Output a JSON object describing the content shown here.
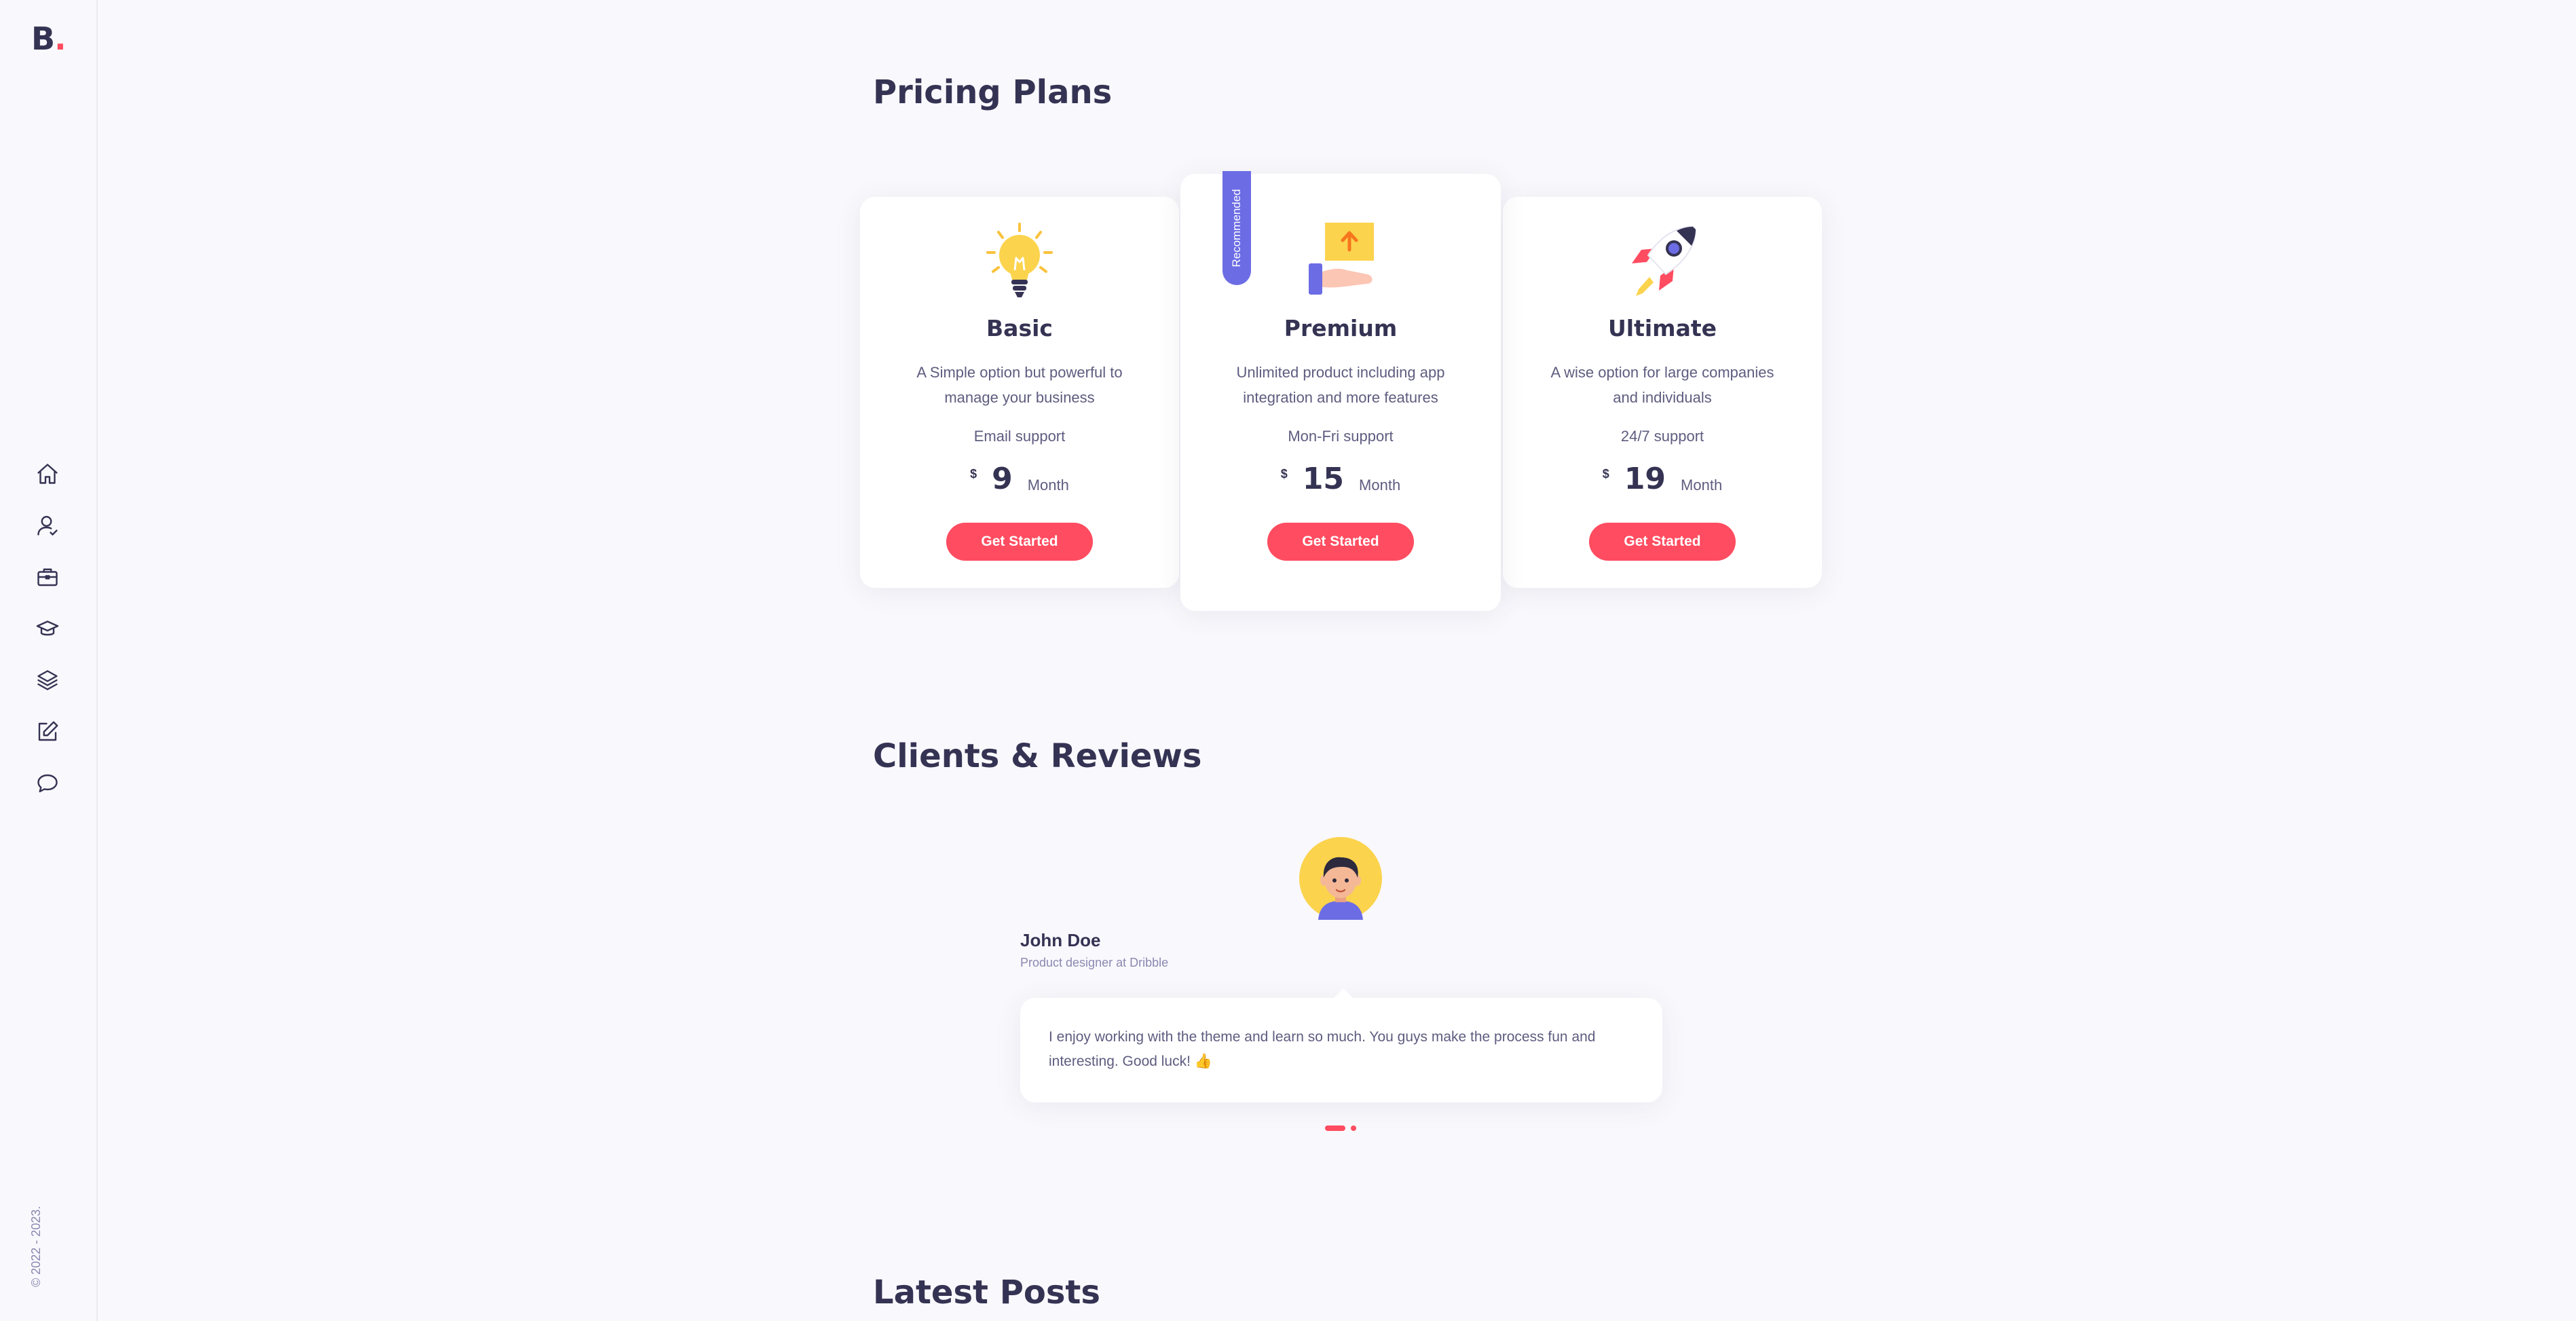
{
  "logo": {
    "letter": "B",
    "dot": "."
  },
  "copyright": "© 2022 - 2023.",
  "nav": [
    {
      "icon": "home-icon",
      "label": "Home"
    },
    {
      "icon": "user-icon",
      "label": "About"
    },
    {
      "icon": "briefcase-icon",
      "label": "Services"
    },
    {
      "icon": "graduation-cap-icon",
      "label": "Experience"
    },
    {
      "icon": "layers-icon",
      "label": "Works"
    },
    {
      "icon": "edit-icon",
      "label": "Blog"
    },
    {
      "icon": "chat-bubble-icon",
      "label": "Contact"
    }
  ],
  "pricing": {
    "title": "Pricing Plans",
    "plans": [
      {
        "name": "Basic",
        "description": "A Simple option but powerful to manage your business",
        "support": "Email support",
        "currency": "$",
        "amount": "9",
        "period": "Month",
        "button": "Get Started",
        "icon": "lightbulb-icon"
      },
      {
        "name": "Premium",
        "description": "Unlimited product including app integration and more features",
        "support": "Mon-Fri support",
        "currency": "$",
        "amount": "15",
        "period": "Month",
        "button": "Get Started",
        "icon": "upload-box-hand-icon",
        "ribbon": "Recommended"
      },
      {
        "name": "Ultimate",
        "description": "A wise option for large companies and individuals",
        "support": "24/7 support",
        "currency": "$",
        "amount": "19",
        "period": "Month",
        "button": "Get Started",
        "icon": "rocket-icon"
      }
    ]
  },
  "reviews": {
    "title": "Clients & Reviews",
    "name": "John Doe",
    "role": "Product designer at Dribble",
    "text": "I enjoy working with the theme and learn so much. You guys make the process fun and interesting. Good luck! 👍"
  },
  "posts": {
    "title": "Latest Posts"
  },
  "colors": {
    "accent": "#ff4c60",
    "ribbon": "#6c6ce5",
    "heading": "#353353",
    "background": "#f9f8fc"
  }
}
